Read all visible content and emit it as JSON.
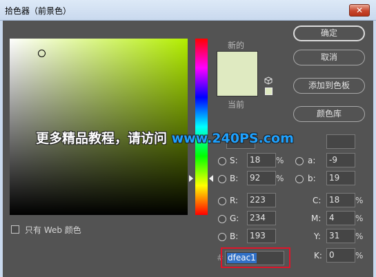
{
  "window": {
    "title": "拾色器（前景色）",
    "close_glyph": "✕"
  },
  "swatches": {
    "new_label": "新的",
    "current_label": "当前",
    "new_color": "#dfeac1",
    "current_color": "#dfeac1"
  },
  "buttons": {
    "ok": "确定",
    "cancel": "取消",
    "add_to_swatches": "添加到色板",
    "color_libraries": "颜色库"
  },
  "watermark": {
    "text": "更多精品教程，请访问 ",
    "url": "www.240PS.com"
  },
  "hsb": {
    "s_label": "S:",
    "s_value": "18",
    "s_unit": "%",
    "b_label": "B:",
    "b_value": "92",
    "b_unit": "%"
  },
  "rgb": {
    "r_label": "R:",
    "r_value": "223",
    "g_label": "G:",
    "g_value": "234",
    "b_label": "B:",
    "b_value": "193"
  },
  "lab": {
    "a_label": "a:",
    "a_value": "-9",
    "b_label": "b:",
    "b_value": "19"
  },
  "cmyk": {
    "c_label": "C:",
    "c_value": "18",
    "m_label": "M:",
    "m_value": "4",
    "y_label": "Y:",
    "y_value": "31",
    "k_label": "K:",
    "k_value": "0",
    "unit": "%"
  },
  "hex": {
    "hash": "#",
    "value": "dfeac1"
  },
  "web_only": {
    "label": "只有 Web 颜色",
    "checked": false
  }
}
